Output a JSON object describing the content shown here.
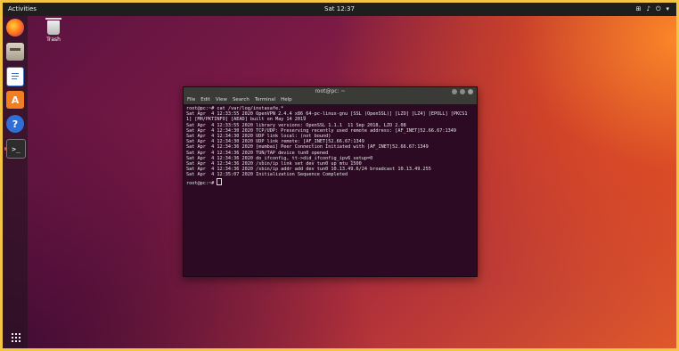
{
  "topbar": {
    "activities": "Activities",
    "clock": "Sat 12:37",
    "tray_icons": [
      "network-icon",
      "volume-icon",
      "power-icon",
      "menu-arrow-icon"
    ]
  },
  "desktop": {
    "trash_label": "Trash"
  },
  "dock": {
    "items": [
      "firefox-icon",
      "files-icon",
      "libreoffice-writer-icon",
      "ubuntu-software-icon",
      "help-icon",
      "terminal-icon"
    ],
    "show_apps": "show-applications-icon"
  },
  "terminal": {
    "title": "root@pc: ~",
    "menu": [
      "File",
      "Edit",
      "View",
      "Search",
      "Terminal",
      "Help"
    ],
    "lines": [
      "root@pc:~# cat /var/log/instasafe.*",
      "Sat Apr  4 12:33:55 2020 OpenVPN 2.4.4 x86_64-pc-linux-gnu [SSL (OpenSSL)] [LZO] [LZ4] [EPOLL] [PKCS11] [MH/PKTINFO] [AEAD] built on May 14 2019",
      "Sat Apr  4 12:33:55 2020 library versions: OpenSSL 1.1.1  11 Sep 2018, LZO 2.08",
      "Sat Apr  4 12:34:30 2020 TCP/UDP: Preserving recently used remote address: [AF_INET]52.66.67:1349",
      "Sat Apr  4 12:34:30 2020 UDP link local: (not bound)",
      "Sat Apr  4 12:34:30 2020 UDP link remote: [AF_INET]52.66.67:1349",
      "Sat Apr  4 12:34:36 2020 [mumbai] Peer Connection Initiated with [AF_INET]52.66.67:1349",
      "Sat Apr  4 12:34:36 2020 TUN/TAP device tun0 opened",
      "Sat Apr  4 12:34:36 2020 do_ifconfig, tt->did_ifconfig_ipv6_setup=0",
      "Sat Apr  4 12:34:36 2020 /sbin/ip link set dev tun0 up mtu 1500",
      "Sat Apr  4 12:34:36 2020 /sbin/ip addr add dev tun0 10.13.49.6/24 broadcast 10.13.49.255",
      "Sat Apr  4 12:35:07 2020 Initialization Sequence Completed"
    ],
    "prompt": "root@pc:~# "
  }
}
